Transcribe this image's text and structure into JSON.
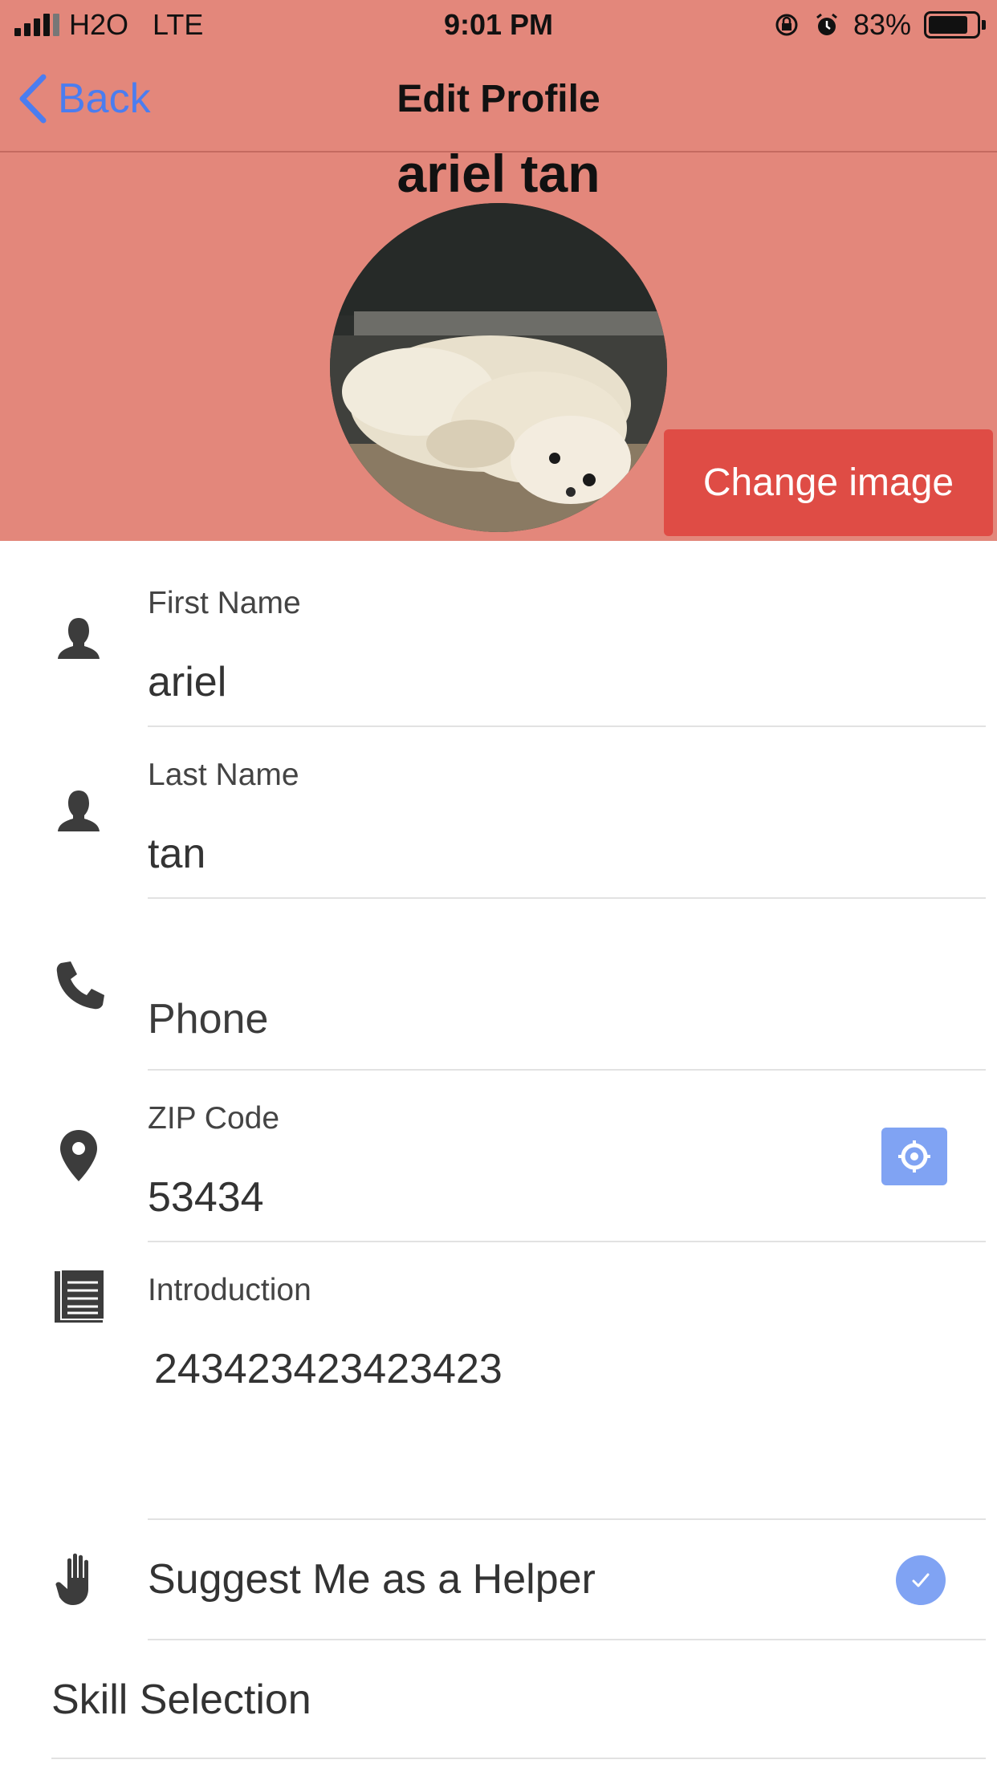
{
  "status_bar": {
    "carrier": "H2O",
    "network": "LTE",
    "time": "9:01 PM",
    "battery_percent": "83%",
    "battery_level": 0.83,
    "icons": [
      "orientation-lock-icon",
      "alarm-icon"
    ]
  },
  "nav": {
    "back_label": "Back",
    "title": "Edit Profile"
  },
  "profile": {
    "name": "ariel tan",
    "change_image_label": "Change image"
  },
  "fields": {
    "first_name": {
      "label": "First Name",
      "value": "ariel",
      "icon": "person-icon"
    },
    "last_name": {
      "label": "Last Name",
      "value": "tan",
      "icon": "person-icon"
    },
    "phone": {
      "placeholder": "Phone",
      "icon": "phone-icon"
    },
    "zip": {
      "label": "ZIP Code",
      "value": "53434",
      "icon": "location-pin-icon",
      "action_icon": "locate-target-icon"
    },
    "introduction": {
      "label": "Introduction",
      "value": "243423423423423",
      "icon": "document-icon"
    }
  },
  "helper": {
    "label": "Suggest Me as a Helper",
    "checked": true,
    "icon": "hand-icon"
  },
  "skill_selection": {
    "label": "Skill Selection"
  },
  "colors": {
    "header_bg": "#e3877b",
    "accent_blue": "#4b7df0",
    "button_red": "#df4c45",
    "toggle_blue": "#80a3f3"
  }
}
